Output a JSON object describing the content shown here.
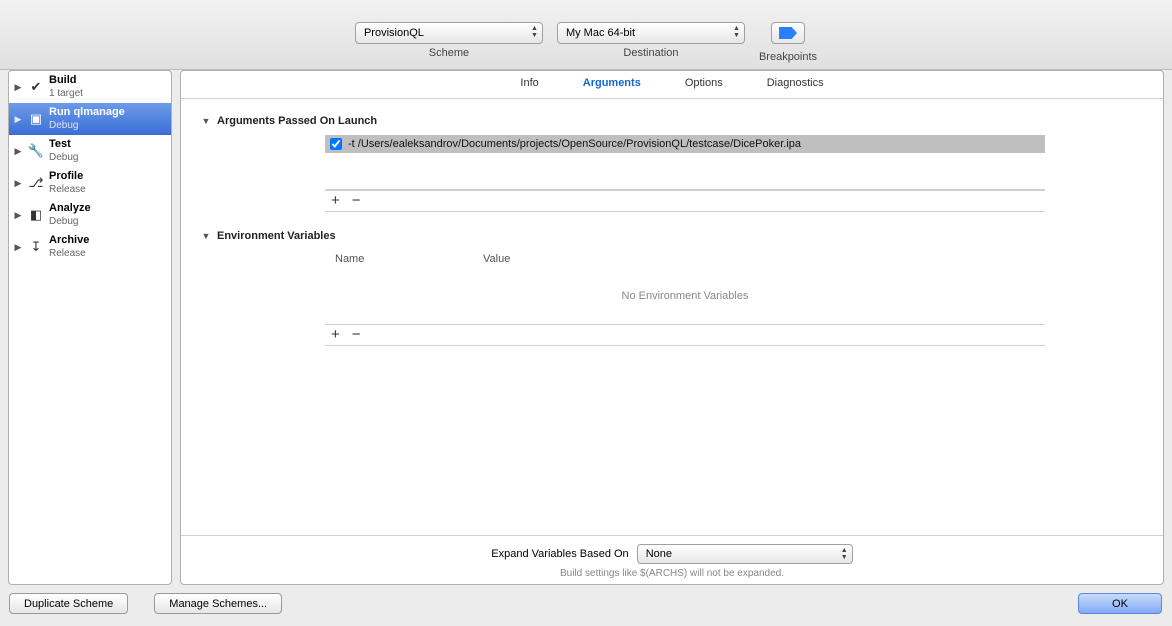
{
  "toolbar": {
    "scheme": {
      "value": "ProvisionQL",
      "label": "Scheme"
    },
    "destination": {
      "value": "My Mac 64-bit",
      "label": "Destination"
    },
    "breakpoints_label": "Breakpoints"
  },
  "sidebar": {
    "items": [
      {
        "title": "Build",
        "sub": "1 target"
      },
      {
        "title": "Run qlmanage",
        "sub": "Debug"
      },
      {
        "title": "Test",
        "sub": "Debug"
      },
      {
        "title": "Profile",
        "sub": "Release"
      },
      {
        "title": "Analyze",
        "sub": "Debug"
      },
      {
        "title": "Archive",
        "sub": "Release"
      }
    ]
  },
  "tabs": {
    "info": "Info",
    "arguments": "Arguments",
    "options": "Options",
    "diagnostics": "Diagnostics"
  },
  "sections": {
    "args_header": "Arguments Passed On Launch",
    "env_header": "Environment Variables",
    "env_name_col": "Name",
    "env_value_col": "Value",
    "env_empty": "No Environment Variables"
  },
  "arguments": [
    {
      "enabled": true,
      "text": "-t /Users/ealeksandrov/Documents/projects/OpenSource/ProvisionQL/testcase/DicePoker.ipa"
    }
  ],
  "footer": {
    "expand_label": "Expand Variables Based On",
    "expand_value": "None",
    "hint": "Build settings like $(ARCHS) will not be expanded."
  },
  "buttons": {
    "duplicate": "Duplicate Scheme",
    "manage": "Manage Schemes...",
    "ok": "OK"
  },
  "glyphs": {
    "plus": "+",
    "minus": "−"
  }
}
